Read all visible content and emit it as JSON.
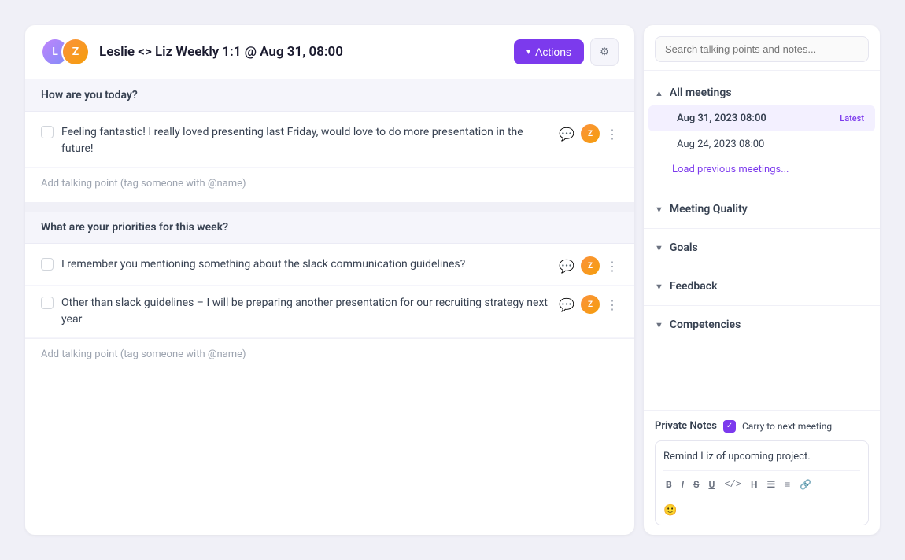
{
  "header": {
    "meeting_title": "Leslie <> Liz Weekly 1:1 @ Aug 31, 08:00",
    "actions_label": "Actions",
    "avatar1_initials": "L",
    "avatar2_initials": "Z"
  },
  "sections": [
    {
      "id": "section-1",
      "title": "How are you today?",
      "items": [
        {
          "id": "item-1",
          "text": "Feeling fantastic! I really loved presenting last Friday, would love to do more presentation in the future!",
          "avatar_type": "orange"
        }
      ],
      "add_placeholder": "Add talking point (tag someone with @name)"
    },
    {
      "id": "section-2",
      "title": "What are your priorities for this week?",
      "items": [
        {
          "id": "item-2",
          "text": "I remember you mentioning something about the slack communication guidelines?",
          "avatar_type": "orange"
        },
        {
          "id": "item-3",
          "text": "Other than slack guidelines – I will be preparing another presentation for our recruiting strategy next year",
          "avatar_type": "orange"
        }
      ],
      "add_placeholder": "Add talking point (tag someone with @name)"
    }
  ],
  "sidebar": {
    "search_placeholder": "Search talking points and notes...",
    "all_meetings_label": "All meetings",
    "meetings": [
      {
        "date": "Aug 31, 2023 08:00",
        "is_active": true,
        "badge": "Latest"
      },
      {
        "date": "Aug 24, 2023 08:00",
        "is_active": false,
        "badge": ""
      }
    ],
    "load_more_label": "Load previous meetings...",
    "nav_sections": [
      {
        "label": "Meeting Quality"
      },
      {
        "label": "Goals"
      },
      {
        "label": "Feedback"
      },
      {
        "label": "Competencies"
      }
    ],
    "private_notes": {
      "label": "Private Notes",
      "carry_label": "Carry to next meeting",
      "note_text": "Remind Liz of upcoming project.",
      "toolbar": [
        "B",
        "I",
        "S",
        "U",
        "</>",
        "H",
        "≡",
        "≡⁻",
        "🔗"
      ]
    }
  }
}
